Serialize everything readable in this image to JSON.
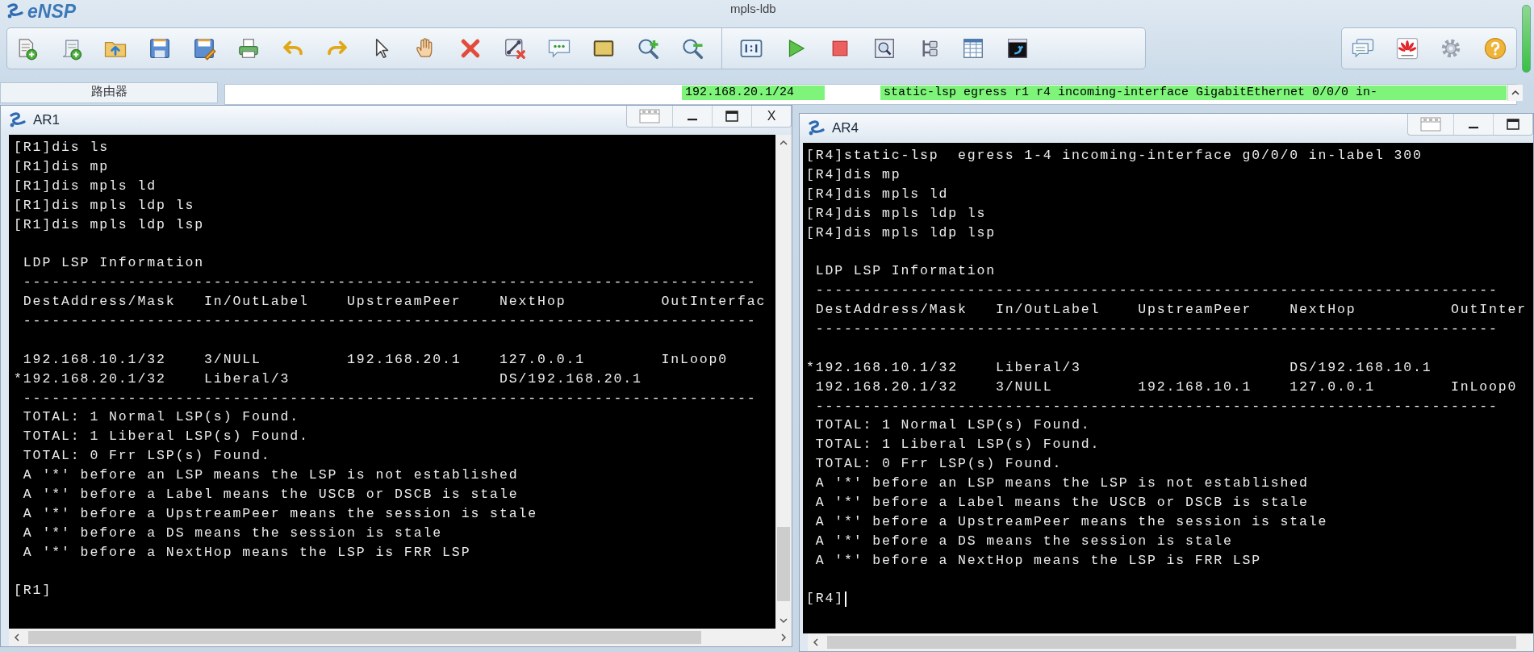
{
  "app": {
    "name": "eNSP",
    "title": "mpls-ldb"
  },
  "device_tab": {
    "label": "路由器"
  },
  "info_bar": {
    "address": "192.168.20.1/24",
    "command": "static-lsp egress r1 r4 incoming-interface GigabitEthernet 0/0/0 in-"
  },
  "consoles": [
    {
      "title": "AR1",
      "cursor": false,
      "vertical_scrollbar": true,
      "controls": [
        {
          "kind": "restore"
        },
        {
          "kind": "minimize"
        },
        {
          "kind": "maximize"
        },
        {
          "kind": "close",
          "label": "X"
        }
      ],
      "lines": [
        {
          "kind": "text",
          "text": "[R1]dis ls"
        },
        {
          "kind": "text",
          "text": "[R1]dis mp"
        },
        {
          "kind": "text",
          "text": "[R1]dis mpls ld"
        },
        {
          "kind": "text",
          "text": "[R1]dis mpls ldp ls"
        },
        {
          "kind": "text",
          "text": "[R1]dis mpls ldp lsp"
        },
        {
          "kind": "blank"
        },
        {
          "kind": "text",
          "text": " LDP LSP Information"
        },
        {
          "kind": "text",
          "text": " -----------------------------------------------------------------------------"
        },
        {
          "kind": "text",
          "text": " DestAddress/Mask   In/OutLabel    UpstreamPeer    NextHop          OutInterfac"
        },
        {
          "kind": "text",
          "text": " -----------------------------------------------------------------------------"
        },
        {
          "kind": "blank"
        },
        {
          "kind": "text",
          "text": " 192.168.10.1/32    3/NULL         192.168.20.1    127.0.0.1        InLoop0"
        },
        {
          "kind": "text",
          "text": "*192.168.20.1/32    Liberal/3                      DS/192.168.20.1"
        },
        {
          "kind": "text",
          "text": " -----------------------------------------------------------------------------"
        },
        {
          "kind": "text",
          "text": " TOTAL: 1 Normal LSP(s) Found."
        },
        {
          "kind": "text",
          "text": " TOTAL: 1 Liberal LSP(s) Found."
        },
        {
          "kind": "text",
          "text": " TOTAL: 0 Frr LSP(s) Found."
        },
        {
          "kind": "text",
          "text": " A '*' before an LSP means the LSP is not established"
        },
        {
          "kind": "text",
          "text": " A '*' before a Label means the USCB or DSCB is stale"
        },
        {
          "kind": "text",
          "text": " A '*' before a UpstreamPeer means the session is stale"
        },
        {
          "kind": "text",
          "text": " A '*' before a DS means the session is stale"
        },
        {
          "kind": "text",
          "text": " A '*' before a NextHop means the LSP is FRR LSP"
        },
        {
          "kind": "blank"
        },
        {
          "kind": "text",
          "text": "[R1]"
        }
      ]
    },
    {
      "title": "AR4",
      "cursor": true,
      "vertical_scrollbar": false,
      "controls": [
        {
          "kind": "restore"
        },
        {
          "kind": "minimize"
        },
        {
          "kind": "maximize"
        }
      ],
      "lines": [
        {
          "kind": "text",
          "text": "[R4]static-lsp  egress 1-4 incoming-interface g0/0/0 in-label 300"
        },
        {
          "kind": "text",
          "text": "[R4]dis mp"
        },
        {
          "kind": "text",
          "text": "[R4]dis mpls ld"
        },
        {
          "kind": "text",
          "text": "[R4]dis mpls ldp ls"
        },
        {
          "kind": "text",
          "text": "[R4]dis mpls ldp lsp"
        },
        {
          "kind": "blank"
        },
        {
          "kind": "text",
          "text": " LDP LSP Information"
        },
        {
          "kind": "text",
          "text": " ------------------------------------------------------------------------"
        },
        {
          "kind": "text",
          "text": " DestAddress/Mask   In/OutLabel    UpstreamPeer    NextHop          OutInter"
        },
        {
          "kind": "text",
          "text": " ------------------------------------------------------------------------"
        },
        {
          "kind": "blank"
        },
        {
          "kind": "text",
          "text": "*192.168.10.1/32    Liberal/3                      DS/192.168.10.1"
        },
        {
          "kind": "text",
          "text": " 192.168.20.1/32    3/NULL         192.168.10.1    127.0.0.1        InLoop0"
        },
        {
          "kind": "text",
          "text": " ------------------------------------------------------------------------"
        },
        {
          "kind": "text",
          "text": " TOTAL: 1 Normal LSP(s) Found."
        },
        {
          "kind": "text",
          "text": " TOTAL: 1 Liberal LSP(s) Found."
        },
        {
          "kind": "text",
          "text": " TOTAL: 0 Frr LSP(s) Found."
        },
        {
          "kind": "text",
          "text": " A '*' before an LSP means the LSP is not established"
        },
        {
          "kind": "text",
          "text": " A '*' before a Label means the USCB or DSCB is stale"
        },
        {
          "kind": "text",
          "text": " A '*' before a UpstreamPeer means the session is stale"
        },
        {
          "kind": "text",
          "text": " A '*' before a DS means the session is stale"
        },
        {
          "kind": "text",
          "text": " A '*' before a NextHop means the LSP is FRR LSP"
        },
        {
          "kind": "blank"
        },
        {
          "kind": "text",
          "text": "[R4]"
        }
      ]
    }
  ]
}
